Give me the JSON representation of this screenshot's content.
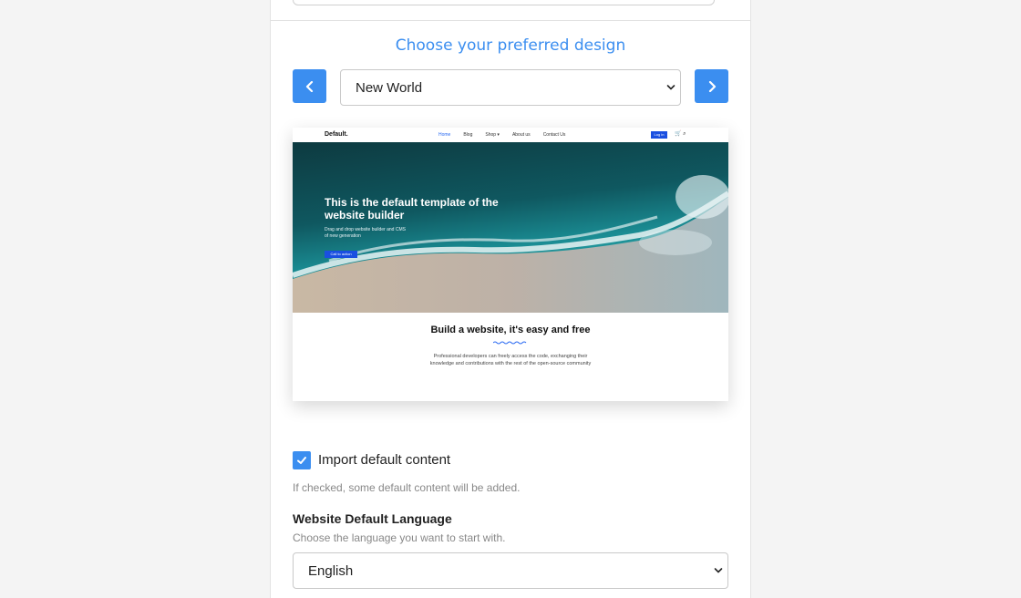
{
  "design": {
    "heading": "Choose your preferred design",
    "selected": "New World",
    "prev_icon": "chevron-left-icon",
    "next_icon": "chevron-right-icon",
    "accent_color": "#3b8ef0"
  },
  "preview": {
    "nav": {
      "logo": "Default.",
      "links": [
        "Home",
        "Blog",
        "Shop ▾",
        "About us",
        "Contact Us"
      ],
      "login": "Log in"
    },
    "hero": {
      "title": "This is the default template of the website builder",
      "subtitle": "Drag and drop website builder and CMS of new generation",
      "cta": "Call to action"
    },
    "body": {
      "title": "Build a website, it's easy and free",
      "text": "Professional developers can freely access the code, exchanging their knowledge and contributions with the rest of the open-source community"
    }
  },
  "import_content": {
    "checked": true,
    "label": "Import default content",
    "help": "If checked, some default content will be added."
  },
  "language": {
    "title": "Website Default Language",
    "help": "Choose the language you want to start with.",
    "selected": "English"
  }
}
